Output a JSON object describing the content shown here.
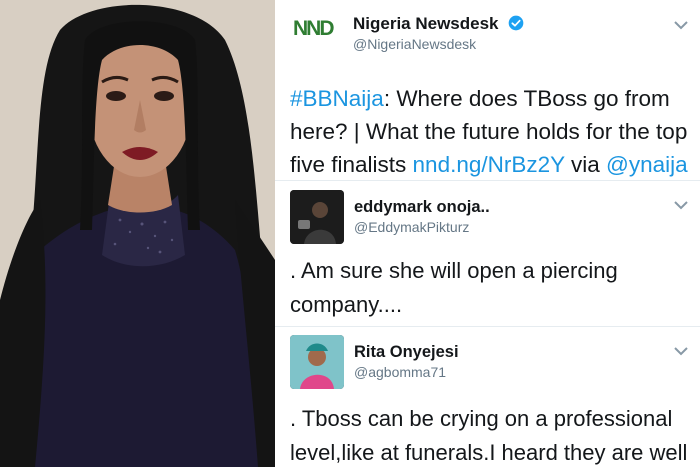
{
  "main_tweet": {
    "logo_text": "NND",
    "name": "Nigeria Newsdesk",
    "handle": "@NigeriaNewsdesk",
    "text_hashtag": "#BBNaija",
    "text_body": ": Where does TBoss go from here? | What the future holds for the top five finalists ",
    "text_link": "nnd.ng/NrBz2Y",
    "text_via": " via ",
    "text_mention": "@ynaija",
    "link_color": "#1b95e0",
    "verified_icon": "verified-badge-icon"
  },
  "replies": [
    {
      "name": "eddymark onoja..",
      "handle": "@EddymakPikturz",
      "text": ". Am sure she will open a piercing company...."
    },
    {
      "name": "Rita Onyejesi",
      "handle": "@agbomma71",
      "text": ". Tboss can be crying on a professional level,like at funerals.I heard they are well"
    }
  ]
}
